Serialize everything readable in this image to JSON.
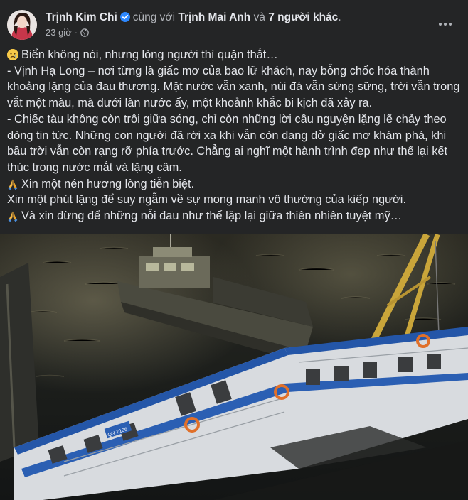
{
  "post": {
    "author": "Trịnh Kim Chi",
    "with_text": "cùng với",
    "tagged_person": "Trịnh Mai Anh",
    "and_text": "và",
    "others": "7 người khác",
    "period": ".",
    "timestamp": "23 giờ",
    "dot": "·",
    "privacy_icon": "globe-icon",
    "verified_icon": "verified-badge-icon",
    "more_icon": "more-horizontal-icon"
  },
  "text": {
    "line1": "Biển không nói, nhưng lòng người thì quặn thắt…",
    "para1": "- Vịnh Hạ Long – nơi từng là giấc mơ của bao lữ khách, nay bỗng chốc hóa thành khoảng lặng của đau thương. Mặt nước vẫn xanh, núi đá vẫn sừng sững, trời vẫn trong vắt một màu, mà dưới làn nước ấy, một khoảnh khắc bi kịch đã xảy ra.",
    "para2": "- Chiếc tàu không còn trôi giữa sóng, chỉ còn những lời cầu nguyện lặng lẽ chảy theo dòng tin tức. Những con người đã rời xa khi vẫn còn dang dở giấc mơ khám phá, khi bầu trời vẫn còn rạng rỡ phía trước. Chẳng ai nghĩ một hành trình đẹp như thế lại kết thúc trong nước mắt và lặng câm.",
    "line_pray1": "Xin một nén hương lòng tiễn biệt.",
    "line_silence": "Xin một phút lặng để suy ngẫm về sự mong manh vô thường của kiếp người.",
    "line_pray2": "Và xin đừng để những nỗi đau như thế lặp lại giữa thiên nhiên tuyệt mỹ…"
  },
  "photo": {
    "hull_label": "QN-7105"
  },
  "colors": {
    "background": "#242526",
    "text": "#e4e6eb",
    "muted": "#b0b3b8",
    "verified": "#2d88ff"
  }
}
